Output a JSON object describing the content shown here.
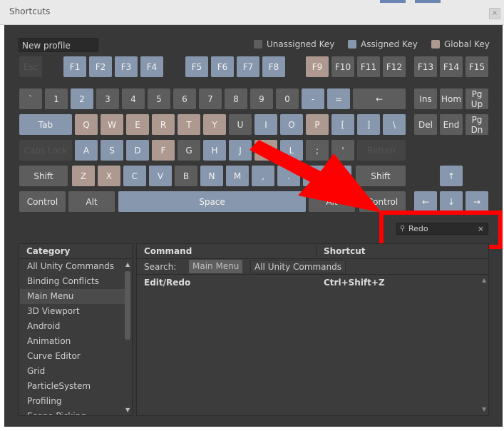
{
  "window": {
    "title": "Shortcuts"
  },
  "profile": {
    "value": "New profile"
  },
  "legend": {
    "unassigned": "Unassigned Key",
    "assigned": "Assigned Key",
    "global": "Global Key"
  },
  "colors": {
    "unassigned": "#5d5d5d",
    "assigned": "#8797ad",
    "global": "#ad998f",
    "highlight": "#ff0000"
  },
  "keys": {
    "esc": "Esc",
    "f1": "F1",
    "f2": "F2",
    "f3": "F3",
    "f4": "F4",
    "f5": "F5",
    "f6": "F6",
    "f7": "F7",
    "f8": "F8",
    "f9": "F9",
    "f10": "F10",
    "f11": "F11",
    "f12": "F12",
    "f13": "F13",
    "f14": "F14",
    "f15": "F15",
    "backquote": "`",
    "d1": "1",
    "d2": "2",
    "d3": "3",
    "d4": "4",
    "d5": "5",
    "d6": "6",
    "d7": "7",
    "d8": "8",
    "d9": "9",
    "d0": "0",
    "minus": "-",
    "equals": "=",
    "backspace": "←",
    "ins": "Ins",
    "home": "Hom",
    "pgup": "Pg Up",
    "tab": "Tab",
    "q": "Q",
    "w": "W",
    "e": "E",
    "r": "R",
    "t": "T",
    "y": "Y",
    "u": "U",
    "i": "I",
    "o": "O",
    "p": "P",
    "lbracket": "[",
    "rbracket": "]",
    "backslash": "\\",
    "del": "Del",
    "end": "End",
    "pgdn": "Pg Dn",
    "capslock": "Caps Lock",
    "a": "A",
    "s": "S",
    "d": "D",
    "f": "F",
    "g": "G",
    "h": "H",
    "j": "J",
    "k": "K",
    "l": "L",
    "semicolon": ";",
    "quote": "'",
    "return": "Return",
    "lshift": "Shift",
    "z": "Z",
    "x": "X",
    "c": "C",
    "v": "V",
    "b": "B",
    "n": "N",
    "m": "M",
    "comma": ",",
    "period": ".",
    "slash": "/",
    "rshift": "Shift",
    "up": "↑",
    "lcontrol": "Control",
    "lalt": "Alt",
    "space": "Space",
    "ralt": "Alt",
    "rcontrol": "Control",
    "left": "←",
    "down": "↓",
    "right": "→"
  },
  "search": {
    "value": "Redo"
  },
  "category": {
    "header": "Category",
    "items": [
      "All Unity Commands",
      "Binding Conflicts",
      "Main Menu",
      "3D Viewport",
      "Android",
      "Animation",
      "Curve Editor",
      "Grid",
      "ParticleSystem",
      "Profiling",
      "Scene Picking"
    ],
    "selected": "Main Menu"
  },
  "commands": {
    "col_command": "Command",
    "col_shortcut": "Shortcut",
    "search_label": "Search:",
    "scope_main": "Main Menu",
    "scope_all": "All Unity Commands",
    "rows": [
      {
        "command": "Edit/Redo",
        "shortcut": "Ctrl+Shift+Z"
      }
    ]
  }
}
